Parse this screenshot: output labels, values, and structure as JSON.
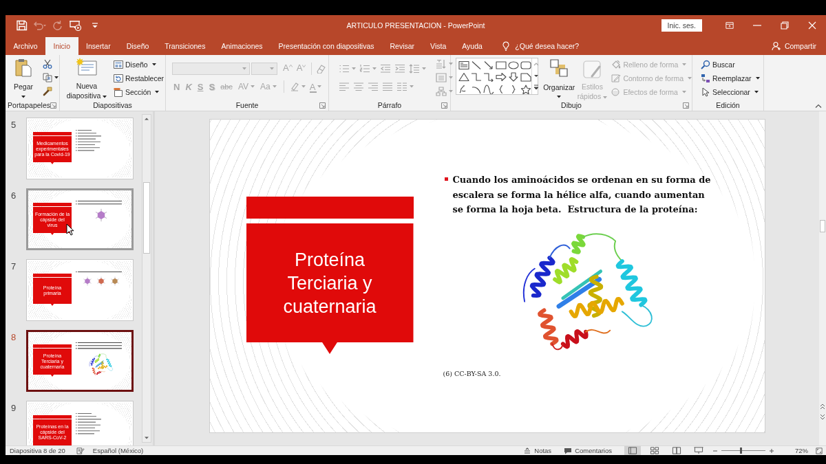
{
  "window": {
    "title": "ARTICULO PRESENTACION - PowerPoint",
    "sign_in": "Inic. ses."
  },
  "quick_access": [
    {
      "kind": "save",
      "disabled": false
    },
    {
      "kind": "undo",
      "disabled": true
    },
    {
      "kind": "redo",
      "disabled": true
    },
    {
      "kind": "slideshow",
      "disabled": false
    },
    {
      "kind": "customize",
      "disabled": false
    }
  ],
  "tabs": [
    {
      "label": "Archivo",
      "selected": false
    },
    {
      "label": "Inicio",
      "selected": true
    },
    {
      "label": "Insertar",
      "selected": false
    },
    {
      "label": "Diseño",
      "selected": false
    },
    {
      "label": "Transiciones",
      "selected": false
    },
    {
      "label": "Animaciones",
      "selected": false
    },
    {
      "label": "Presentación con diapositivas",
      "selected": false
    },
    {
      "label": "Revisar",
      "selected": false
    },
    {
      "label": "Vista",
      "selected": false
    },
    {
      "label": "Ayuda",
      "selected": false
    }
  ],
  "tell_me": {
    "label": "¿Qué desea hacer?"
  },
  "share": {
    "label": "Compartir"
  },
  "ribbon": [
    {
      "kind": "clipboard",
      "label": "Portapapeles",
      "launcher": true,
      "paste": {
        "label": "Pegar",
        "dropdown": true
      }
    },
    {
      "kind": "slides",
      "label": "Diapositivas",
      "launcher": false,
      "new_slide": {
        "label": "Nueva diapositiva",
        "dropdown": true
      },
      "commands": [
        {
          "kind": "layout",
          "label": "Diseño",
          "dropdown": true
        },
        {
          "kind": "reset",
          "label": "Restablecer",
          "dropdown": false
        },
        {
          "kind": "section",
          "label": "Sección",
          "dropdown": true
        }
      ]
    },
    {
      "kind": "font",
      "label": "Fuente",
      "launcher": true,
      "disabled": true,
      "size_buttons": [
        {
          "kind": "grow",
          "label": "A"
        },
        {
          "kind": "shrink",
          "label": "A"
        }
      ],
      "format_buttons": [
        {
          "kind": "bold",
          "label": "N"
        },
        {
          "kind": "italic",
          "label": "K"
        },
        {
          "kind": "underline",
          "label": "S"
        },
        {
          "kind": "shadow",
          "label": "S"
        },
        {
          "kind": "strike",
          "label": "abc"
        },
        {
          "kind": "spacing",
          "label": "AV"
        },
        {
          "kind": "case",
          "label": "Aa"
        },
        {
          "kind": "color",
          "label": "A"
        }
      ]
    },
    {
      "kind": "paragraph",
      "label": "Párrafo",
      "launcher": true,
      "disabled": true
    },
    {
      "kind": "drawing",
      "label": "Dibujo",
      "launcher": true,
      "arrange": {
        "label": "Organizar",
        "dropdown": true
      },
      "quick_styles": {
        "label": "Estilos rápidos",
        "disabled": true
      },
      "format_commands": [
        {
          "kind": "fill",
          "label": "Relleno de forma",
          "disabled": true
        },
        {
          "kind": "outline",
          "label": "Contorno de forma",
          "disabled": true
        },
        {
          "kind": "effects",
          "label": "Efectos de forma",
          "disabled": true
        }
      ]
    },
    {
      "kind": "editing",
      "label": "Edición",
      "launcher": false,
      "commands": [
        {
          "kind": "find",
          "label": "Buscar",
          "dropdown": false
        },
        {
          "kind": "replace",
          "label": "Reemplazar",
          "dropdown": true
        },
        {
          "kind": "select",
          "label": "Seleccionar",
          "dropdown": true
        }
      ]
    }
  ],
  "slide_panel": {
    "slides": [
      {
        "number": "5",
        "title": "Medicamentos experimentales para la Covid-19",
        "kind": "text",
        "selected": false,
        "hovered": false
      },
      {
        "number": "6",
        "title": "Formación de la cápside del virus",
        "kind": "virus",
        "selected": false,
        "hovered": true
      },
      {
        "number": "7",
        "title": "Proteína primaria",
        "kind": "viruses",
        "selected": false,
        "hovered": false
      },
      {
        "number": "8",
        "title": "Proteína Terciaria y cuaternaria",
        "kind": "protein",
        "selected": true,
        "hovered": false
      },
      {
        "number": "9",
        "title": "Proteínas en la cápside del SARS-CoV-2",
        "kind": "text",
        "selected": false,
        "hovered": false
      }
    ]
  },
  "slide": {
    "title": "Proteína Terciaria y cuaternaria",
    "bullets": [
      "Cuando los aminoácidos se ordenan en su forma de escalera se forma la hélice alfa, cuando aumentan se forma la hoja beta.  Estructura de la proteína:"
    ],
    "caption": "(6) CC-BY-SA 3.0."
  },
  "status_bar": {
    "slide_info": "Diapositiva 8 de 20",
    "language": "Español (México)",
    "notes": "Notas",
    "comments": "Comentarios",
    "views": [
      {
        "kind": "normal",
        "selected": true
      },
      {
        "kind": "sorter",
        "selected": false
      },
      {
        "kind": "reading",
        "selected": false
      },
      {
        "kind": "slideshow",
        "selected": false
      }
    ],
    "zoom": {
      "level": 0.45,
      "reading": "72%"
    }
  }
}
